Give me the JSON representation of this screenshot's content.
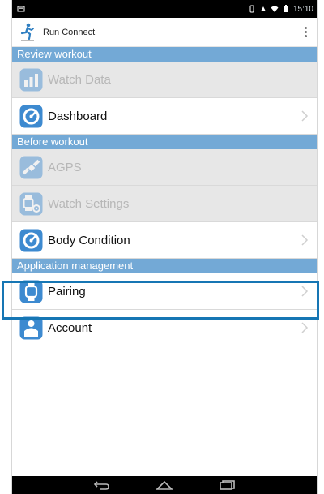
{
  "status_bar": {
    "time": "15:10",
    "icons": [
      "notification-icon",
      "vibrate-icon",
      "wifi-icon",
      "battery-icon"
    ]
  },
  "app_bar": {
    "title": "Run Connect",
    "logo_icon": "runner-icon",
    "menu_icon": "overflow-menu-icon"
  },
  "sections": [
    {
      "header": "Review workout",
      "items": [
        {
          "label": "Watch Data",
          "enabled": false,
          "icon": "bar-chart-icon"
        },
        {
          "label": "Dashboard",
          "enabled": true,
          "icon": "dashboard-icon"
        }
      ]
    },
    {
      "header": "Before workout",
      "items": [
        {
          "label": "AGPS",
          "enabled": false,
          "icon": "satellite-icon"
        },
        {
          "label": "Watch Settings",
          "enabled": false,
          "icon": "watch-settings-icon"
        },
        {
          "label": "Body Condition",
          "enabled": true,
          "icon": "body-condition-icon"
        }
      ]
    },
    {
      "header": "Application management",
      "items": [
        {
          "label": "Pairing",
          "enabled": true,
          "icon": "watch-icon",
          "highlighted": true
        },
        {
          "label": "Account",
          "enabled": true,
          "icon": "account-icon"
        }
      ]
    }
  ],
  "colors": {
    "section_header": "#73a9d6",
    "highlight_border": "#1676b4",
    "disabled_row": "#e7e7e7",
    "icon_blue": "#3d8ad0"
  },
  "nav_bar": {
    "buttons": [
      "back-icon",
      "home-icon",
      "recent-apps-icon"
    ]
  }
}
